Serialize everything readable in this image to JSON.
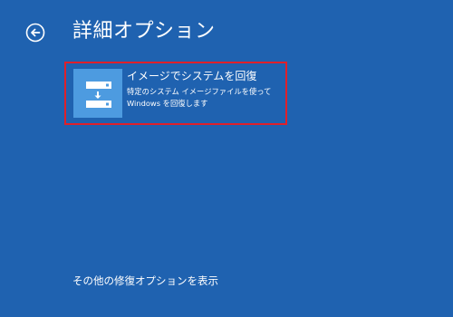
{
  "header": {
    "back_icon": "back-arrow-circle-icon",
    "title": "詳細オプション"
  },
  "options": [
    {
      "icon": "drive-restore-icon",
      "title": "イメージでシステムを回復",
      "description_line1": "特定のシステム イメージファイルを使って",
      "description_line2": "Windows を回復します",
      "selected": true
    }
  ],
  "footer": {
    "more_options_link": "その他の修復オプションを表示"
  },
  "colors": {
    "background": "#1f62b0",
    "icon_tile": "#4d9be0",
    "selection_border": "#e0202a",
    "text": "#ffffff"
  }
}
